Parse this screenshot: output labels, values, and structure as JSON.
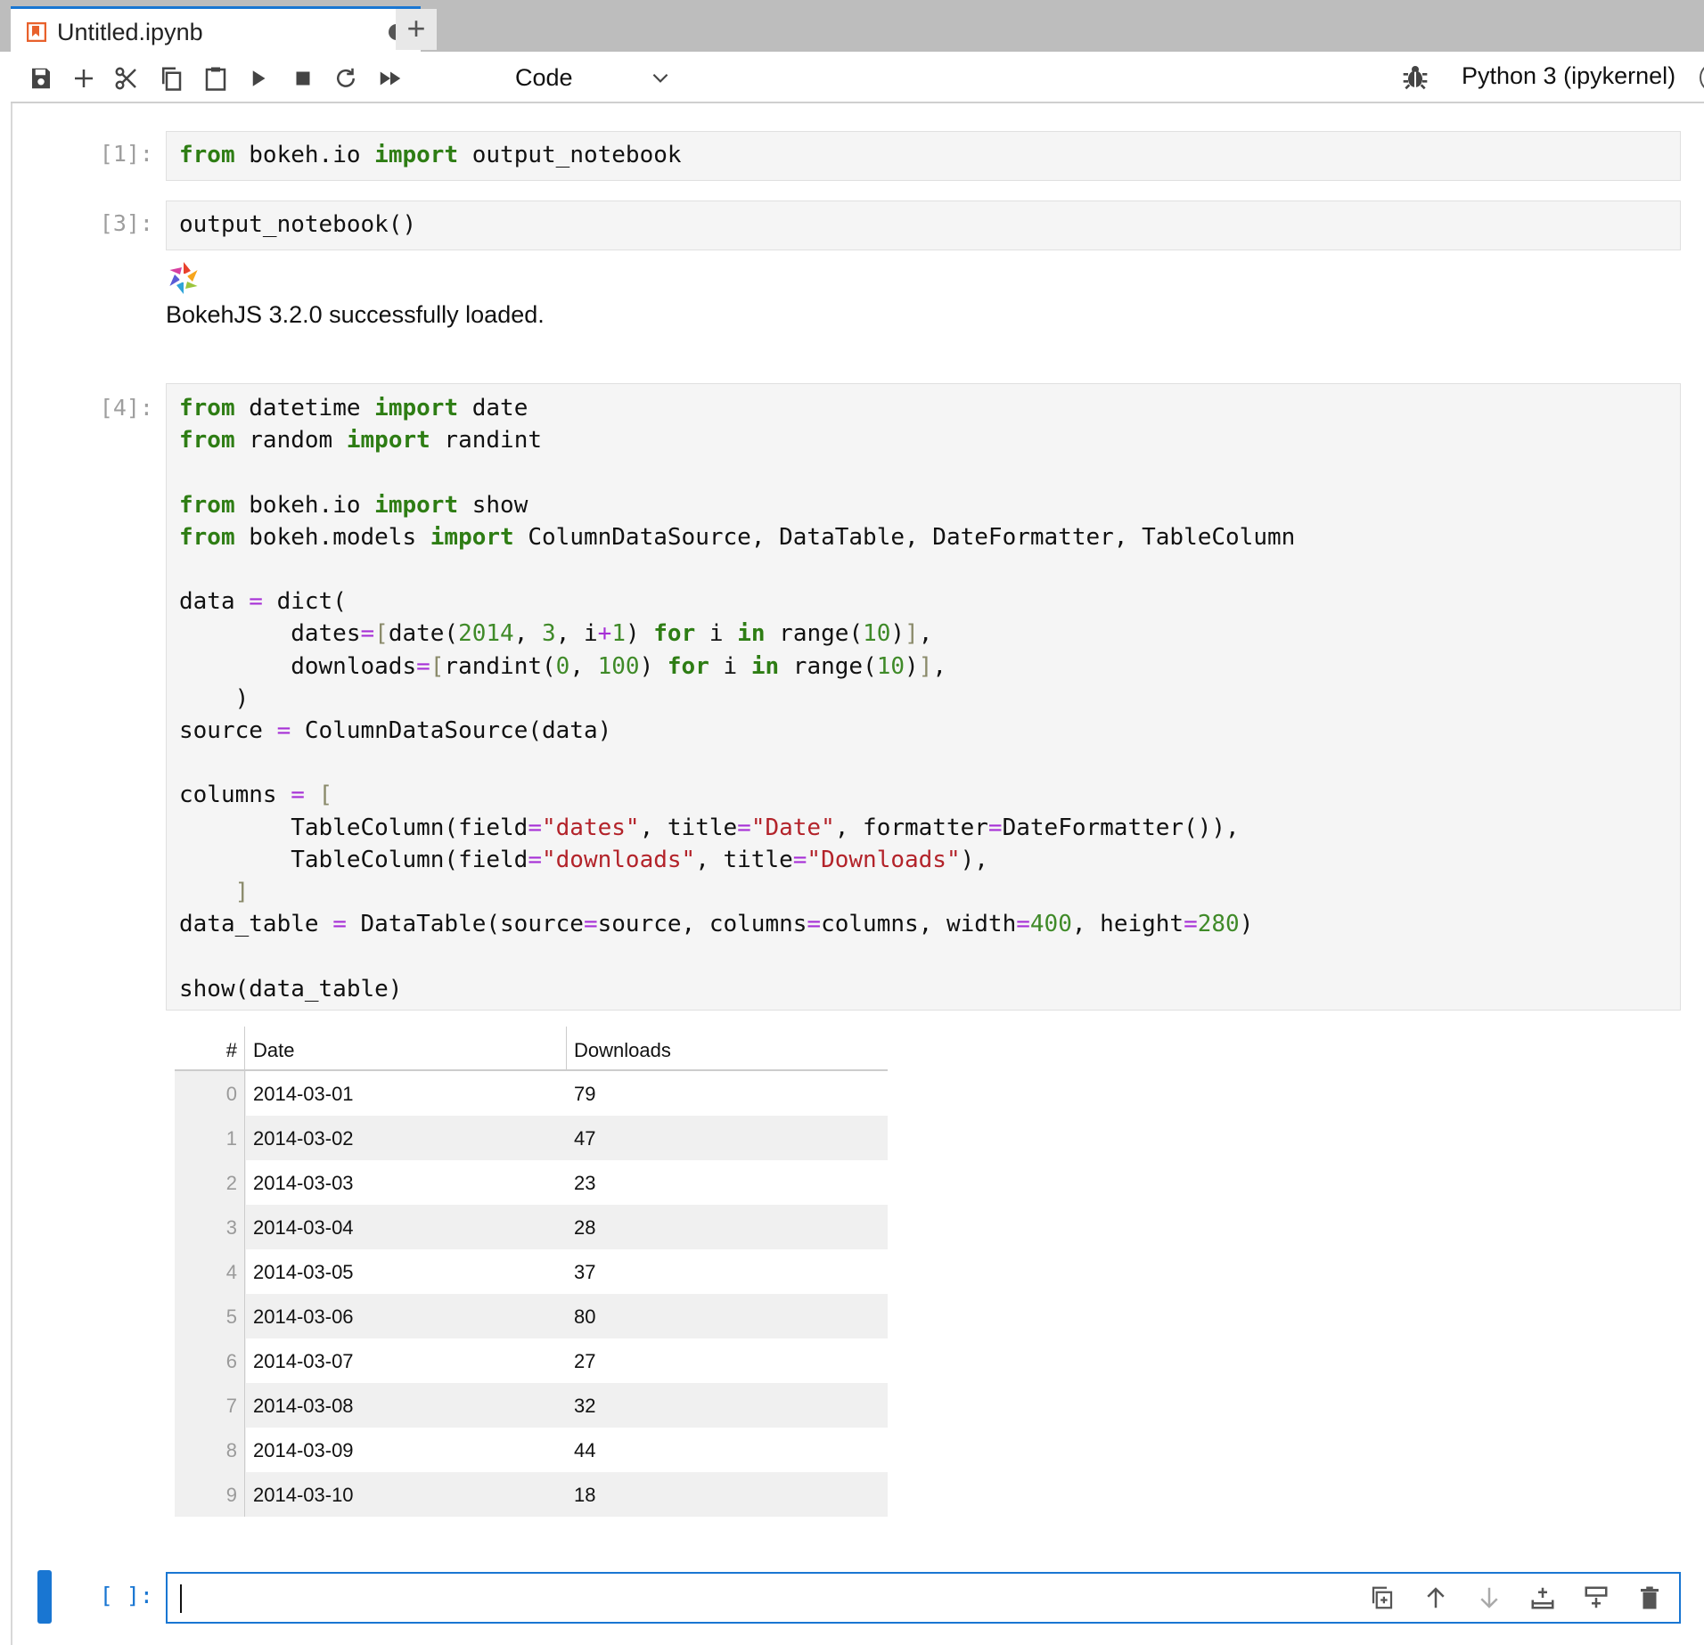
{
  "tab": {
    "title": "Untitled.ipynb",
    "new_tab_label": "+"
  },
  "toolbar": {
    "cell_type": "Code",
    "kernel_name": "Python 3 (ipykernel)",
    "icons": [
      "save-icon",
      "add-cell-icon",
      "cut-icon",
      "copy-icon",
      "paste-icon",
      "run-icon",
      "stop-icon",
      "restart-icon",
      "fast-forward-icon"
    ]
  },
  "cells": [
    {
      "prompt": "[1]:",
      "lines": [
        "from bokeh.io import output_notebook"
      ]
    },
    {
      "prompt": "[3]:",
      "lines": [
        "output_notebook()"
      ],
      "output": "BokehJS 3.2.0 successfully loaded."
    },
    {
      "prompt": "[4]:",
      "lines": [
        "from datetime import date",
        "from random import randint",
        "",
        "from bokeh.io import show",
        "from bokeh.models import ColumnDataSource, DataTable, DateFormatter, TableColumn",
        "",
        "data = dict(",
        "        dates=[date(2014, 3, i+1) for i in range(10)],",
        "        downloads=[randint(0, 100) for i in range(10)],",
        "    )",
        "source = ColumnDataSource(data)",
        "",
        "columns = [",
        "        TableColumn(field=\"dates\", title=\"Date\", formatter=DateFormatter()),",
        "        TableColumn(field=\"downloads\", title=\"Downloads\"),",
        "    ]",
        "data_table = DataTable(source=source, columns=columns, width=400, height=280)",
        "",
        "show(data_table)"
      ]
    },
    {
      "prompt": "[ ]:",
      "lines": []
    }
  ],
  "table": {
    "headers": [
      "#",
      "Date",
      "Downloads"
    ],
    "rows": [
      [
        "0",
        "2014-03-01",
        "79"
      ],
      [
        "1",
        "2014-03-02",
        "47"
      ],
      [
        "2",
        "2014-03-03",
        "23"
      ],
      [
        "3",
        "2014-03-04",
        "28"
      ],
      [
        "4",
        "2014-03-05",
        "37"
      ],
      [
        "5",
        "2014-03-06",
        "80"
      ],
      [
        "6",
        "2014-03-07",
        "27"
      ],
      [
        "7",
        "2014-03-08",
        "32"
      ],
      [
        "8",
        "2014-03-09",
        "44"
      ],
      [
        "9",
        "2014-03-10",
        "18"
      ]
    ]
  },
  "cell_tools": [
    "duplicate-cell-icon",
    "move-up-icon",
    "move-down-icon",
    "insert-above-icon",
    "insert-below-icon",
    "delete-cell-icon"
  ]
}
